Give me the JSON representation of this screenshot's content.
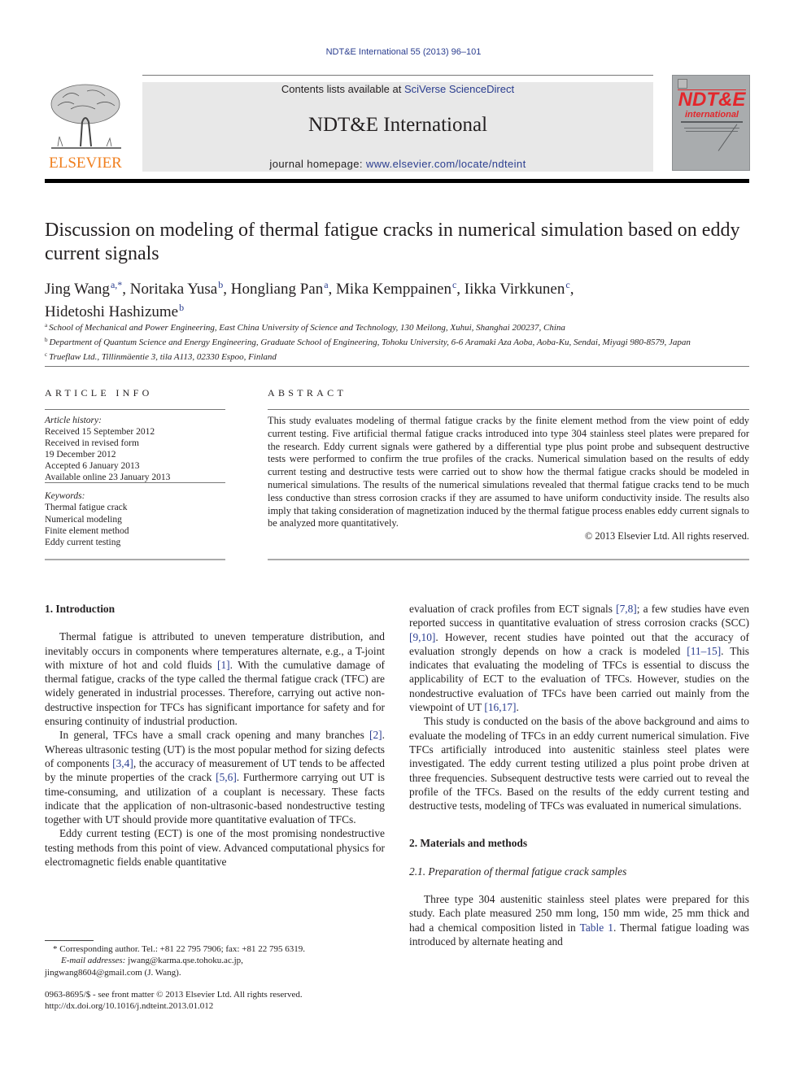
{
  "header": {
    "citation": "NDT&E International 55 (2013) 96–101",
    "contents_prefix": "Contents lists available at ",
    "contents_link": "SciVerse ScienceDirect",
    "journal_name": "NDT&E International",
    "homepage_prefix": "journal homepage: ",
    "homepage_link": "www.elsevier.com/locate/ndteint",
    "publisher_logo_text": "ELSEVIER",
    "cover_title": "NDT&E",
    "cover_subtitle": "international"
  },
  "article": {
    "title": "Discussion on modeling of thermal fatigue cracks in numerical simulation based on eddy current signals",
    "authors": [
      {
        "name": "Jing Wang",
        "affil": "a,*",
        "sep": ", "
      },
      {
        "name": "Noritaka Yusa",
        "affil": "b",
        "sep": ", "
      },
      {
        "name": "Hongliang Pan",
        "affil": "a",
        "sep": ", "
      },
      {
        "name": "Mika Kemppainen",
        "affil": "c",
        "sep": ", "
      },
      {
        "name": "Iikka Virkkunen",
        "affil": "c",
        "sep": ","
      },
      {
        "name": "Hidetoshi Hashizume",
        "affil": "b",
        "sep": ""
      }
    ],
    "affiliations": [
      {
        "key": "a",
        "text": "School of Mechanical and Power Engineering, East China University of Science and Technology, 130 Meilong, Xuhui, Shanghai 200237, China"
      },
      {
        "key": "b",
        "text": "Department of Quantum Science and Energy Engineering, Graduate School of Engineering, Tohoku University, 6-6 Aramaki Aza Aoba, Aoba-Ku, Sendai, Miyagi 980-8579, Japan"
      },
      {
        "key": "c",
        "text": "Trueflaw Ltd., Tillinmäentie 3, tila A113, 02330 Espoo, Finland"
      }
    ]
  },
  "article_info": {
    "heading": "ARTICLE INFO",
    "history_label": "Article history:",
    "history": [
      "Received 15 September 2012",
      "Received in revised form",
      "19 December 2012",
      "Accepted 6 January 2013",
      "Available online 23 January 2013"
    ],
    "keywords_label": "Keywords:",
    "keywords": [
      "Thermal fatigue crack",
      "Numerical modeling",
      "Finite element method",
      "Eddy current testing"
    ]
  },
  "abstract": {
    "heading": "ABSTRACT",
    "text": "This study evaluates modeling of thermal fatigue cracks by the finite element method from the view point of eddy current testing. Five artificial thermal fatigue cracks introduced into type 304 stainless steel plates were prepared for the research. Eddy current signals were gathered by a differential type plus point probe and subsequent destructive tests were performed to confirm the true profiles of the cracks. Numerical simulation based on the results of eddy current testing and destructive tests were carried out to show how the thermal fatigue cracks should be modeled in numerical simulations. The results of the numerical simulations revealed that thermal fatigue cracks tend to be much less conductive than stress corrosion cracks if they are assumed to have uniform conductivity inside. The results also imply that taking consideration of magnetization induced by the thermal fatigue process enables eddy current signals to be analyzed more quantitatively.",
    "copyright": "© 2013 Elsevier Ltd. All rights reserved."
  },
  "sections": {
    "intro_heading": "1.  Introduction",
    "intro_p1": [
      {
        "t": "Thermal fatigue is attributed to uneven temperature distribution, and inevitably occurs in components where temperatures alternate, e.g., a T-joint with mixture of hot and cold fluids "
      },
      {
        "t": "[1]",
        "link": true
      },
      {
        "t": ". With the cumulative damage of thermal fatigue, cracks of the type called the thermal fatigue crack (TFC) are widely generated in industrial processes. Therefore, carrying out active non-destructive inspection for TFCs has significant importance for safety and for ensuring continuity of industrial production."
      }
    ],
    "intro_p2": [
      {
        "t": "In general, TFCs have a small crack opening and many branches "
      },
      {
        "t": "[2]",
        "link": true
      },
      {
        "t": ". Whereas ultrasonic testing (UT) is the most popular method for sizing defects of components "
      },
      {
        "t": "[3,4]",
        "link": true
      },
      {
        "t": ", the accuracy of measurement of UT tends to be affected by the minute properties of the crack "
      },
      {
        "t": "[5,6]",
        "link": true
      },
      {
        "t": ". Furthermore carrying out UT is time-consuming, and utilization of a couplant is necessary. These facts indicate that the application of non-ultrasonic-based nondestructive testing together with UT should provide more quantitative evaluation of TFCs."
      }
    ],
    "intro_p3": [
      {
        "t": "Eddy current testing (ECT) is one of the most promising nondestructive testing methods from this point of view. Advanced computational physics for electromagnetic fields enable quantitative "
      }
    ],
    "right_p1": [
      {
        "t": "evaluation of crack profiles from ECT signals "
      },
      {
        "t": "[7,8]",
        "link": true
      },
      {
        "t": "; a few studies have even reported success in quantitative evaluation of stress corrosion cracks (SCC) "
      },
      {
        "t": "[9,10]",
        "link": true
      },
      {
        "t": ". However, recent studies have pointed out that the accuracy of evaluation strongly depends on how a crack is modeled "
      },
      {
        "t": "[11–15]",
        "link": true
      },
      {
        "t": ". This indicates that evaluating the modeling of TFCs is essential to discuss the applicability of ECT to the evaluation of TFCs. However, studies on the nondestructive evaluation of TFCs have been carried out mainly from the viewpoint of UT "
      },
      {
        "t": "[16,17]",
        "link": true
      },
      {
        "t": "."
      }
    ],
    "right_p2": [
      {
        "t": "This study is conducted on the basis of the above background and aims to evaluate the modeling of TFCs in an eddy current numerical simulation. Five TFCs artificially introduced into austenitic stainless steel plates were investigated. The eddy current testing utilized a plus point probe driven at three frequencies. Subsequent destructive tests were carried out to reveal the profile of the TFCs. Based on the results of the eddy current testing and destructive tests, modeling of TFCs was evaluated in numerical simulations."
      }
    ],
    "methods_heading": "2.  Materials and methods",
    "subsec_heading": "2.1.  Preparation of thermal fatigue crack samples",
    "methods_p1": [
      {
        "t": "Three type 304 austenitic stainless steel plates were prepared for this study. Each plate measured 250 mm long, 150 mm wide, 25 mm thick and had a chemical composition listed in "
      },
      {
        "t": "Table 1",
        "link": true
      },
      {
        "t": ". Thermal fatigue loading was introduced by alternate heating and"
      }
    ]
  },
  "footnotes": {
    "corresponding": "* Corresponding author. Tel.: +81 22 795 7906; fax: +81 22 795 6319.",
    "email_label": "E-mail addresses:",
    "email_1": " jwang@karma.qse.tohoku.ac.jp,",
    "email_2": "jingwang8604@gmail.com (J. Wang).",
    "issn": "0963-8695/$ - see front matter © 2013 Elsevier Ltd. All rights reserved.",
    "doi": "http://dx.doi.org/10.1016/j.ndteint.2013.01.012"
  }
}
